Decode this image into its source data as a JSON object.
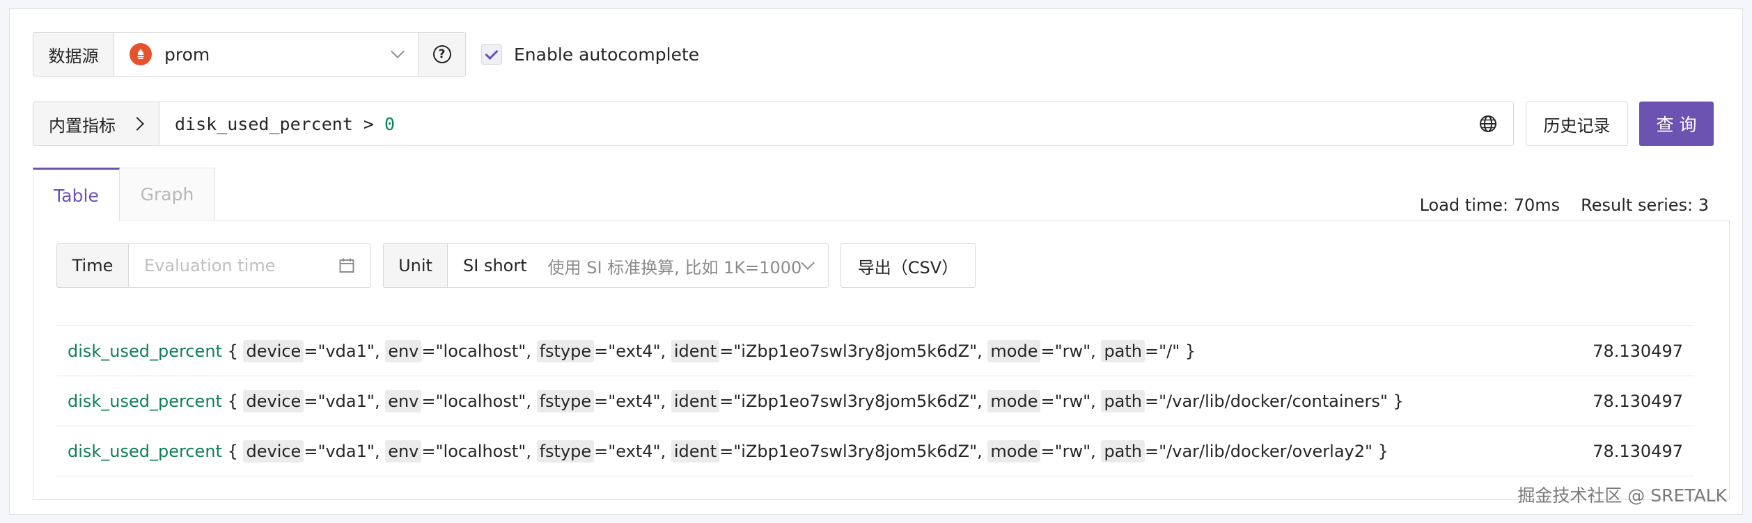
{
  "datasource": {
    "label": "数据源",
    "value": "prom",
    "help_symbol": "?"
  },
  "autocomplete": {
    "label": "Enable autocomplete",
    "checked": true
  },
  "query": {
    "builtin_label": "内置指标",
    "expression_metric": "disk_used_percent",
    "expression_operator": " > ",
    "expression_value": "0",
    "history_label": "历史记录",
    "submit_label": "查询"
  },
  "tabs": [
    {
      "label": "Table",
      "active": true
    },
    {
      "label": "Graph",
      "active": false
    }
  ],
  "stats": {
    "load_time": "Load time: 70ms",
    "result_series": "Result series: 3"
  },
  "controls": {
    "time_label": "Time",
    "time_placeholder": "Evaluation time",
    "unit_label": "Unit",
    "unit_value": "SI short",
    "unit_description": "使用 SI 标准换算, 比如 1K=1000",
    "export_label": "导出（CSV）"
  },
  "results": [
    {
      "metric": "disk_used_percent",
      "labels": [
        {
          "key": "device",
          "value": "\"vda1\""
        },
        {
          "key": "env",
          "value": "\"localhost\""
        },
        {
          "key": "fstype",
          "value": "\"ext4\""
        },
        {
          "key": "ident",
          "value": "\"iZbp1eo7swl3ry8jom5k6dZ\""
        },
        {
          "key": "mode",
          "value": "\"rw\""
        },
        {
          "key": "path",
          "value": "\"/\""
        }
      ],
      "value": "78.130497"
    },
    {
      "metric": "disk_used_percent",
      "labels": [
        {
          "key": "device",
          "value": "\"vda1\""
        },
        {
          "key": "env",
          "value": "\"localhost\""
        },
        {
          "key": "fstype",
          "value": "\"ext4\""
        },
        {
          "key": "ident",
          "value": "\"iZbp1eo7swl3ry8jom5k6dZ\""
        },
        {
          "key": "mode",
          "value": "\"rw\""
        },
        {
          "key": "path",
          "value": "\"/var/lib/docker/containers\""
        }
      ],
      "value": "78.130497"
    },
    {
      "metric": "disk_used_percent",
      "labels": [
        {
          "key": "device",
          "value": "\"vda1\""
        },
        {
          "key": "env",
          "value": "\"localhost\""
        },
        {
          "key": "fstype",
          "value": "\"ext4\""
        },
        {
          "key": "ident",
          "value": "\"iZbp1eo7swl3ry8jom5k6dZ\""
        },
        {
          "key": "mode",
          "value": "\"rw\""
        },
        {
          "key": "path",
          "value": "\"/var/lib/docker/overlay2\""
        }
      ],
      "value": "78.130497"
    }
  ],
  "watermark": "掘金技术社区 @ SRETALK",
  "colors": {
    "accent": "#6c53b1",
    "metric": "#0f8056",
    "prometheus": "#e6522c",
    "number": "#098658"
  },
  "icons": [
    "prometheus-logo",
    "chevron-down-icon",
    "help-icon",
    "check-icon",
    "chevron-right-icon",
    "globe-icon",
    "calendar-icon"
  ]
}
